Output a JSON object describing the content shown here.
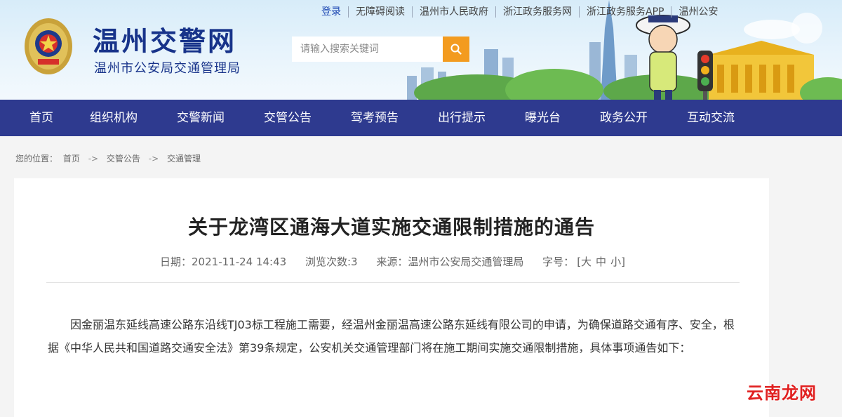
{
  "header": {
    "title": "温州交警网",
    "subtitle": "温州市公安局交通管理局",
    "emblem_icon": "police-emblem-icon",
    "top_links": [
      "登录",
      "无障碍阅读",
      "温州市人民政府",
      "浙江政务服务网",
      "浙江政务服务APP",
      "温州公安"
    ],
    "search_placeholder": "请输入搜索关键词",
    "search_icon": "search-icon",
    "colors": {
      "title": "#17338a",
      "nav": "#2e3a8f",
      "search_button": "#f39b1f"
    }
  },
  "nav": {
    "items": [
      "首页",
      "组织机构",
      "交警新闻",
      "交管公告",
      "驾考预告",
      "出行提示",
      "曝光台",
      "政务公开",
      "互动交流"
    ]
  },
  "breadcrumb": {
    "prefix": "您的位置：",
    "items": [
      "首页",
      "交管公告",
      "交通管理"
    ],
    "separator": "->"
  },
  "article": {
    "title": "关于龙湾区通海大道实施交通限制措施的通告",
    "date_label": "日期：",
    "date": "2021-11-24 14:43",
    "views_label": "浏览次数:",
    "views": "3",
    "source_label": "来源：",
    "source": "温州市公安局交通管理局",
    "font_label": "字号：",
    "font_options": [
      "[大",
      "中",
      "小]"
    ],
    "paragraph": "因金丽温东延线高速公路东沿线TJ03标工程施工需要，经温州金丽温高速公路东延线有限公司的申请，为确保道路交通有序、安全，根据《中华人民共和国道路交通安全法》第39条规定，公安机关交通管理部门将在施工期间实施交通限制措施，具体事项通告如下："
  },
  "watermark": "云南龙网"
}
